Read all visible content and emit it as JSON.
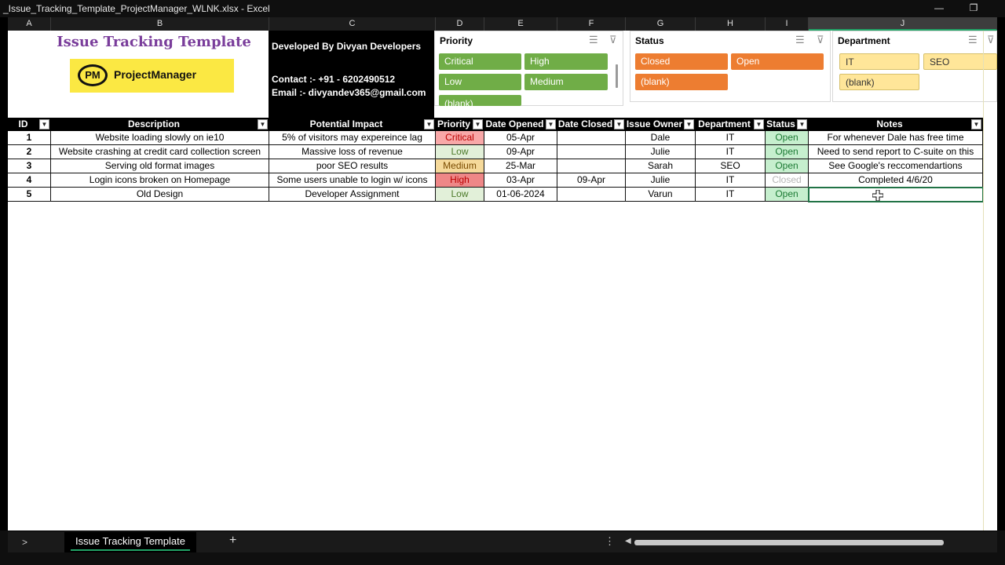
{
  "window": {
    "title": "_Issue_Tracking_Template_ProjectManager_WLNK.xlsx - Excel",
    "minimize_glyph": "—",
    "restore_glyph": "❐"
  },
  "columns": [
    "A",
    "B",
    "C",
    "D",
    "E",
    "F",
    "G",
    "H",
    "I",
    "J"
  ],
  "branding": {
    "title": "Issue Tracking Template",
    "logo_mark": "PM",
    "logo_text": "ProjectManager",
    "logo_bg": "#fbe843",
    "title_color": "#7a3d9b"
  },
  "developer": {
    "line1": "Developed By Divyan Developers",
    "line2": "Contact :- +91 - 6202490512",
    "line3": "Email :- divyandev365@gmail.com"
  },
  "slicers": {
    "priority": {
      "title": "Priority",
      "items": [
        "Critical",
        "High",
        "Low",
        "Medium",
        "(blank)"
      ],
      "color": "#70ad47"
    },
    "status": {
      "title": "Status",
      "items": [
        "Closed",
        "Open",
        "(blank)"
      ],
      "color": "#ed7d31"
    },
    "department": {
      "title": "Department",
      "items": [
        "IT",
        "SEO",
        "(blank)"
      ],
      "color": "#ffe699"
    },
    "multiselect_icon": "☰",
    "clear_filter_icon": "⊽"
  },
  "table": {
    "headers": [
      "ID",
      "Description",
      "Potential Impact",
      "Priority",
      "Date Opened",
      "Date Closed",
      "Issue Owner",
      "Department",
      "Status",
      "Notes"
    ],
    "rows": [
      [
        "1",
        "Website loading slowly on ie10",
        "5% of visitors may expereince lag",
        "Critical",
        "05-Apr",
        "",
        "Dale",
        "IT",
        "Open",
        "For whenever Dale has free time"
      ],
      [
        "2",
        "Website crashing at credit card collection screen",
        "Massive loss of revenue",
        "Low",
        "09-Apr",
        "",
        "Julie",
        "IT",
        "Open",
        "Need to send report to C-suite on this"
      ],
      [
        "3",
        "Serving old format images",
        "poor SEO results",
        "Medium",
        "25-Mar",
        "",
        "Sarah",
        "SEO",
        "Open",
        "See Google's reccomendartions"
      ],
      [
        "4",
        "Login icons broken on Homepage",
        "Some users unable to login w/ icons",
        "High",
        "03-Apr",
        "09-Apr",
        "Julie",
        "IT",
        "Closed",
        "Completed 4/6/20"
      ],
      [
        "5",
        "Old Design",
        "Developer Assignment",
        "Low",
        "01-06-2024",
        "",
        "Varun",
        "IT",
        "Open",
        ""
      ]
    ]
  },
  "sheet_tabs": {
    "nav": ">",
    "active": "Issue Tracking Template",
    "add": "+",
    "more": "⋮",
    "scroll_left": "◀"
  }
}
